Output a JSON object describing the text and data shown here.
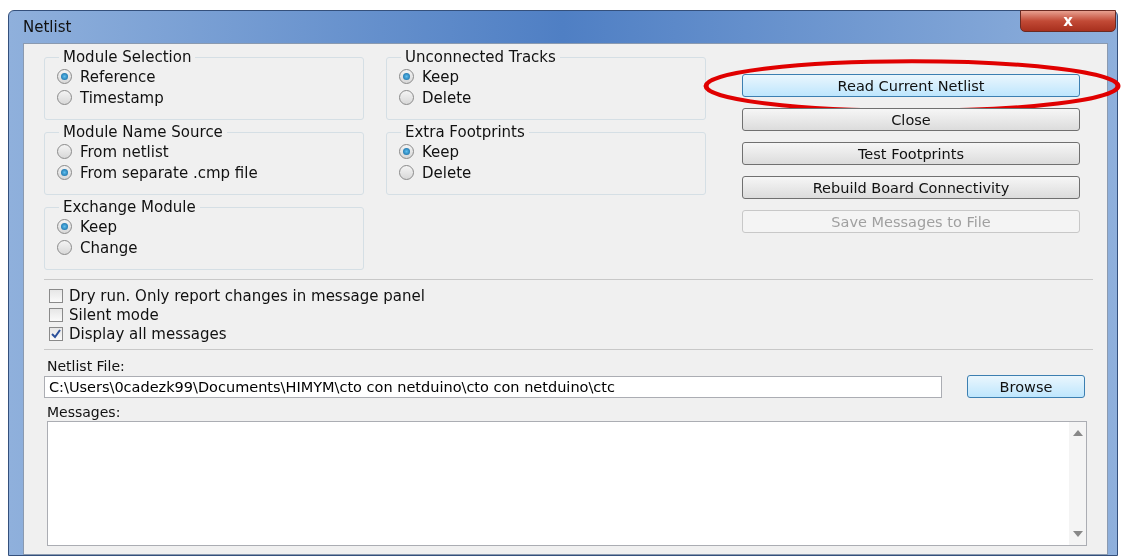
{
  "window": {
    "title": "Netlist",
    "close_label": "x"
  },
  "groups": [
    {
      "title": "Module Selection",
      "options": [
        {
          "label": "Reference",
          "selected": true
        },
        {
          "label": "Timestamp",
          "selected": false
        }
      ]
    },
    {
      "title": "Unconnected Tracks",
      "options": [
        {
          "label": "Keep",
          "selected": true
        },
        {
          "label": "Delete",
          "selected": false
        }
      ]
    },
    {
      "title": "Module Name Source",
      "options": [
        {
          "label": "From netlist",
          "selected": false
        },
        {
          "label": "From separate .cmp file",
          "selected": true
        }
      ]
    },
    {
      "title": "Extra Footprints",
      "options": [
        {
          "label": "Keep",
          "selected": true
        },
        {
          "label": "Delete",
          "selected": false
        }
      ]
    },
    {
      "title": "Exchange Module",
      "options": [
        {
          "label": "Keep",
          "selected": true
        },
        {
          "label": "Change",
          "selected": false
        }
      ]
    }
  ],
  "buttons": [
    {
      "label": "Read Current Netlist",
      "default": true,
      "disabled": false,
      "highlighted": true
    },
    {
      "label": "Close",
      "default": false,
      "disabled": false,
      "highlighted": false
    },
    {
      "label": "Test Footprints",
      "default": false,
      "disabled": false,
      "highlighted": false
    },
    {
      "label": "Rebuild Board Connectivity",
      "default": false,
      "disabled": false,
      "highlighted": false
    },
    {
      "label": "Save Messages to File",
      "default": false,
      "disabled": true,
      "highlighted": false
    }
  ],
  "checkboxes": [
    {
      "label": "Dry run. Only report changes in message panel",
      "checked": false
    },
    {
      "label": "Silent mode",
      "checked": false
    },
    {
      "label": "Display all messages",
      "checked": true
    }
  ],
  "netlist_file": {
    "label": "Netlist File:",
    "value": "C:\\Users\\0cadezk99\\Documents\\HIMYM\\cto con netduino\\cto con netduino\\ctc",
    "browse": "Browse"
  },
  "messages": {
    "label": "Messages:"
  }
}
